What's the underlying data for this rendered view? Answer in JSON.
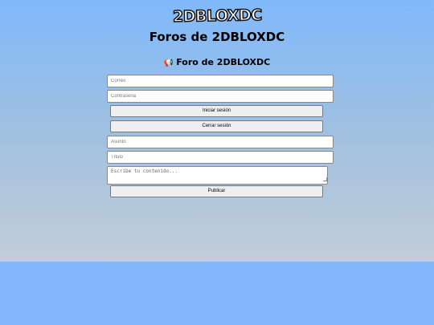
{
  "header": {
    "logo_text": "2DBLOXDC",
    "page_title": "Foros de 2DBLOXDC"
  },
  "forum": {
    "heading": "Foro de 2DBLOXDC",
    "heading_icon": "megaphone-icon"
  },
  "login": {
    "email_placeholder": "Correo",
    "password_placeholder": "Contraseña",
    "login_label": "Iniciar sesión",
    "logout_label": "Cerrar sesión"
  },
  "post": {
    "subject_placeholder": "Asunto",
    "title_placeholder": "Título",
    "content_placeholder": "Escribe tu contenido...",
    "publish_label": "Publicar"
  },
  "colors": {
    "page_background": "#82b8fb",
    "gradient_top": "#80b9fb",
    "gradient_bottom": "#c2cdd8"
  }
}
